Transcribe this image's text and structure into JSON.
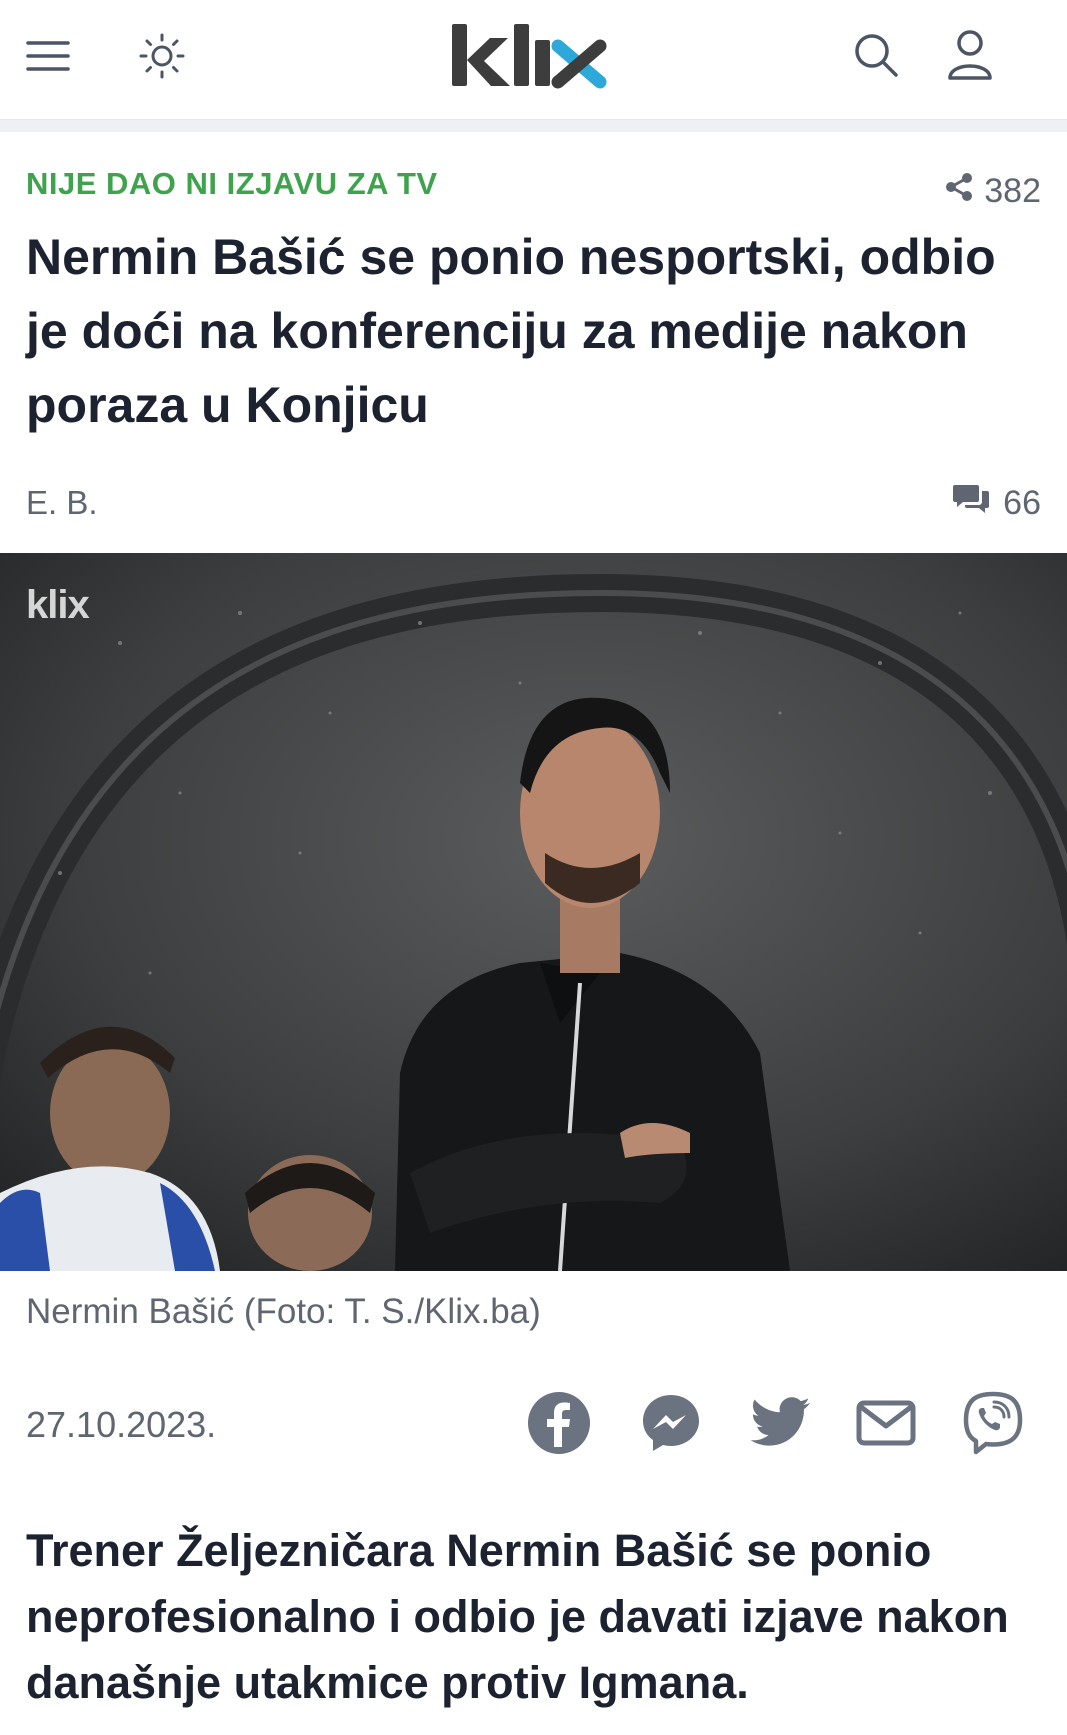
{
  "header": {
    "logo_text": "klix",
    "menu_icon": "hamburger-menu-icon",
    "theme_icon": "sun-icon",
    "search_icon": "search-icon",
    "user_icon": "user-icon",
    "brand_color": "#3d3d3d",
    "accent_color": "#2ea8d8"
  },
  "article": {
    "kicker": "NIJE DAO NI IZJAVU ZA TV",
    "share_count": "382",
    "title": "Nermin Bašić se ponio nesportski, odbio je doći na konferenciju za medije nakon poraza u Konjicu",
    "author": "E. B.",
    "comment_count": "66",
    "photo_watermark": "klix",
    "caption": "Nermin Bašić (Foto: T. S./Klix.ba)",
    "date": "27.10.2023.",
    "share_buttons": [
      "facebook-icon",
      "messenger-icon",
      "twitter-icon",
      "email-icon",
      "viber-icon"
    ],
    "lead": "Trener Željezničara Nermin Bašić se ponio neprofesionalno i odbio je davati izjave nakon današnje utakmice protiv Igmana."
  },
  "colors": {
    "kicker": "#3fa34d",
    "text": "#1d2230",
    "muted": "#5f6672",
    "icon": "#6b7280"
  }
}
